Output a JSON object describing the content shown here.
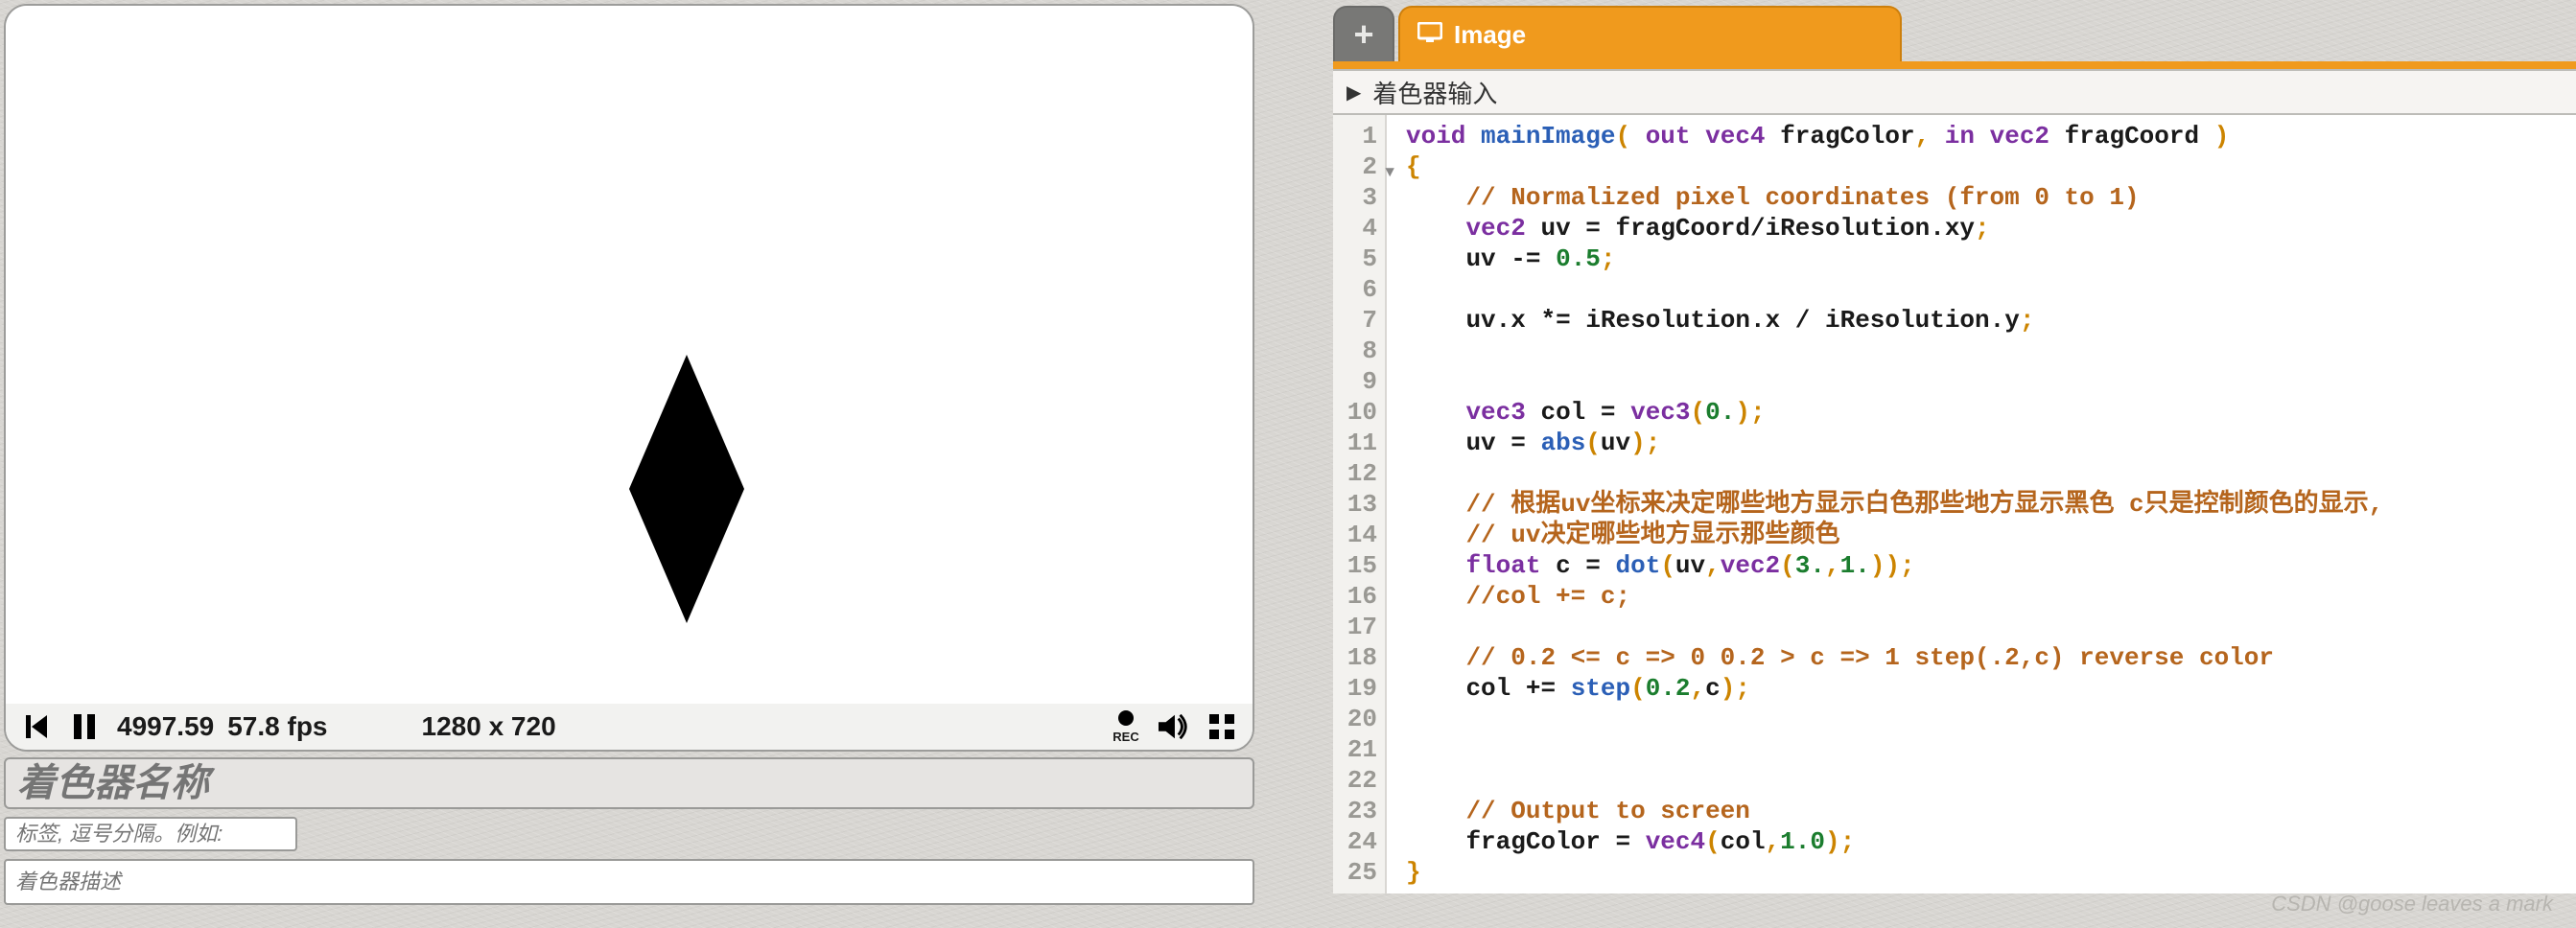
{
  "player": {
    "time": "4997.59",
    "fps": "57.8 fps",
    "resolution": "1280 x 720",
    "rec_label": "REC"
  },
  "form": {
    "name_placeholder": "着色器名称",
    "tags_placeholder": "标签, 逗号分隔。例如: ",
    "desc_placeholder": "着色器描述"
  },
  "tabs": {
    "image": "Image"
  },
  "shader_inputs": {
    "header": "着色器输入"
  },
  "code": {
    "lines": [
      {
        "n": 1,
        "t": "void mainImage( out vec4 fragColor, in vec2 fragCoord )"
      },
      {
        "n": 2,
        "t": "{",
        "fold": true
      },
      {
        "n": 3,
        "t": "    // Normalized pixel coordinates (from 0 to 1)"
      },
      {
        "n": 4,
        "t": "    vec2 uv = fragCoord/iResolution.xy;"
      },
      {
        "n": 5,
        "t": "    uv -= 0.5;"
      },
      {
        "n": 6,
        "t": ""
      },
      {
        "n": 7,
        "t": "    uv.x *= iResolution.x / iResolution.y;"
      },
      {
        "n": 8,
        "t": ""
      },
      {
        "n": 9,
        "t": ""
      },
      {
        "n": 10,
        "t": "    vec3 col = vec3(0.);"
      },
      {
        "n": 11,
        "t": "    uv = abs(uv);"
      },
      {
        "n": 12,
        "t": ""
      },
      {
        "n": 13,
        "t": "    // 根据uv坐标来决定哪些地方显示白色那些地方显示黑色 c只是控制颜色的显示,"
      },
      {
        "n": 14,
        "t": "    // uv决定哪些地方显示那些颜色"
      },
      {
        "n": 15,
        "t": "    float c = dot(uv,vec2(3.,1.));"
      },
      {
        "n": 16,
        "t": "    //col += c;"
      },
      {
        "n": 17,
        "t": ""
      },
      {
        "n": 18,
        "t": "    // 0.2 <= c => 0 0.2 > c => 1 step(.2,c) reverse color"
      },
      {
        "n": 19,
        "t": "    col += step(0.2,c);"
      },
      {
        "n": 20,
        "t": ""
      },
      {
        "n": 21,
        "t": ""
      },
      {
        "n": 22,
        "t": ""
      },
      {
        "n": 23,
        "t": "    // Output to screen"
      },
      {
        "n": 24,
        "t": "    fragColor = vec4(col,1.0);"
      },
      {
        "n": 25,
        "t": "}"
      }
    ]
  },
  "watermark": "CSDN @goose leaves a mark"
}
